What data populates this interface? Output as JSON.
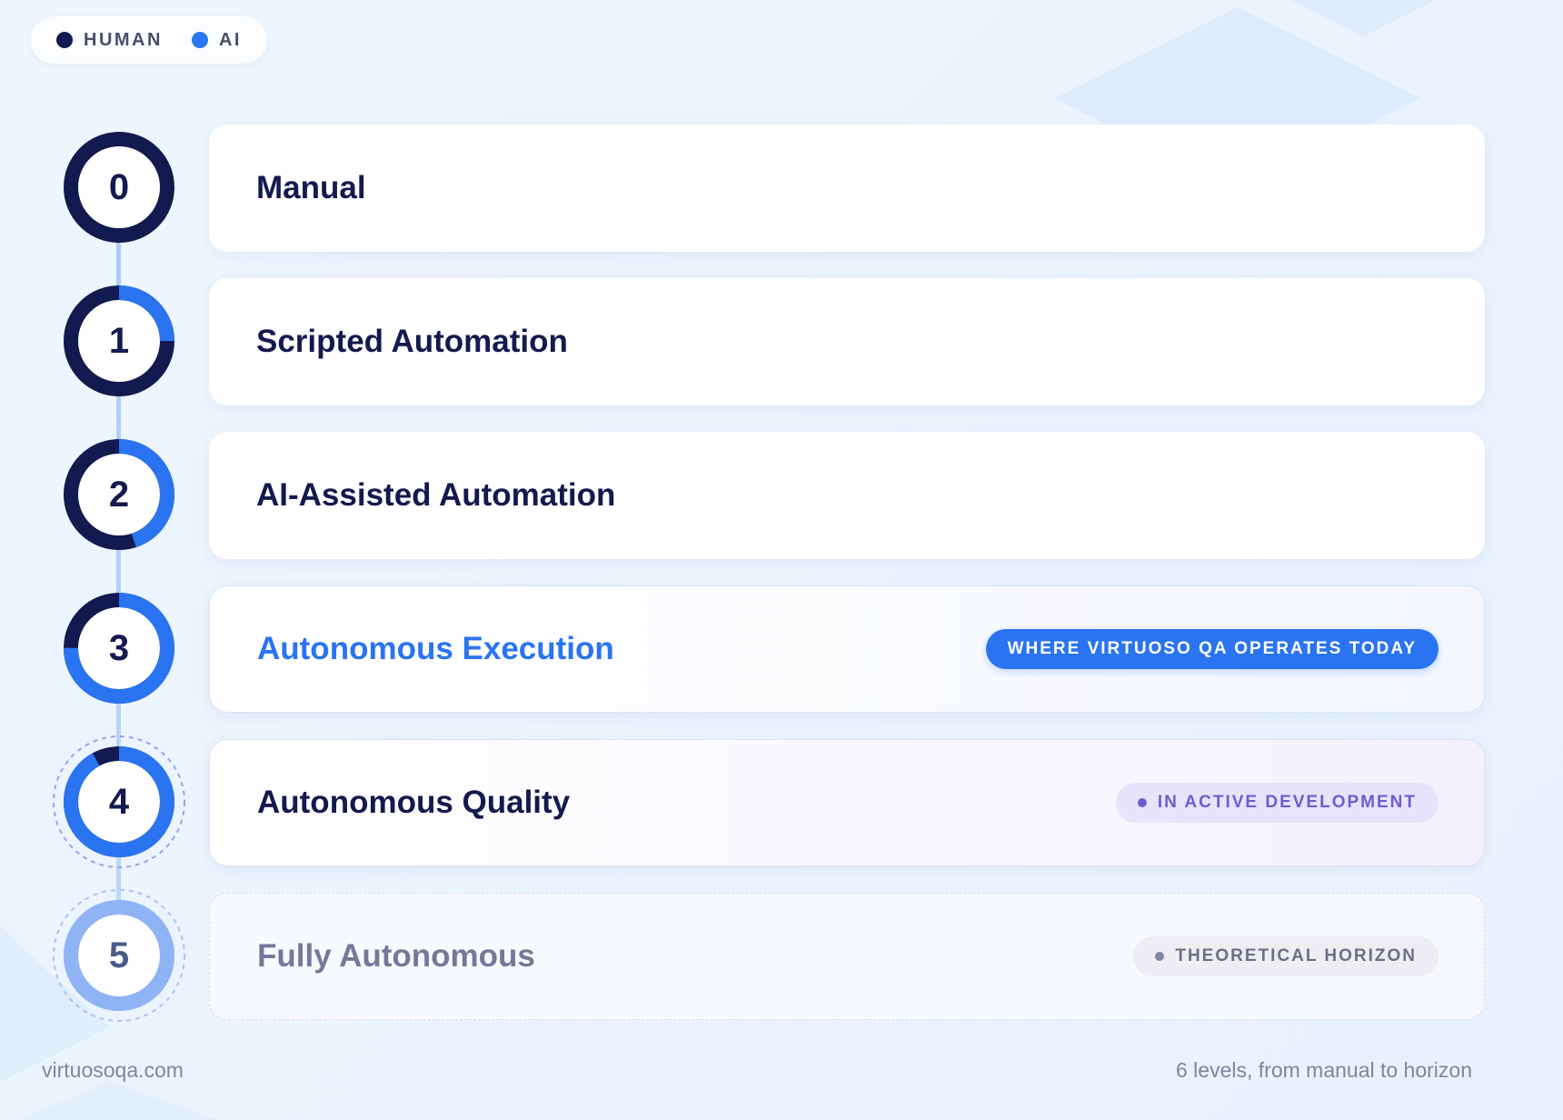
{
  "legend": {
    "human": {
      "label": "HUMAN",
      "color": "#131a4f"
    },
    "ai": {
      "label": "AI",
      "color": "#2a74f2"
    }
  },
  "levels": [
    {
      "number": "0",
      "title": "Manual",
      "ai_share": 0.0,
      "status": "past"
    },
    {
      "number": "1",
      "title": "Scripted Automation",
      "ai_share": 0.25,
      "status": "past"
    },
    {
      "number": "2",
      "title": "AI-Assisted Automation",
      "ai_share": 0.45,
      "status": "past"
    },
    {
      "number": "3",
      "title": "Autonomous Execution",
      "ai_share": 0.75,
      "status": "current",
      "badge": "WHERE VIRTUOSO QA OPERATES TODAY"
    },
    {
      "number": "4",
      "title": "Autonomous Quality",
      "ai_share": 0.92,
      "status": "development",
      "badge": "IN ACTIVE DEVELOPMENT"
    },
    {
      "number": "5",
      "title": "Fully Autonomous",
      "ai_share": 1.0,
      "status": "horizon",
      "badge": "THEORETICAL HORIZON"
    }
  ],
  "colors": {
    "accent": "#2a74f2",
    "dark": "#131a4f",
    "development": "#6a5fd0",
    "horizon": "#8fb3f5"
  },
  "footer": {
    "site": "virtuosoqa.com",
    "summary": "6 levels, from manual to horizon"
  }
}
